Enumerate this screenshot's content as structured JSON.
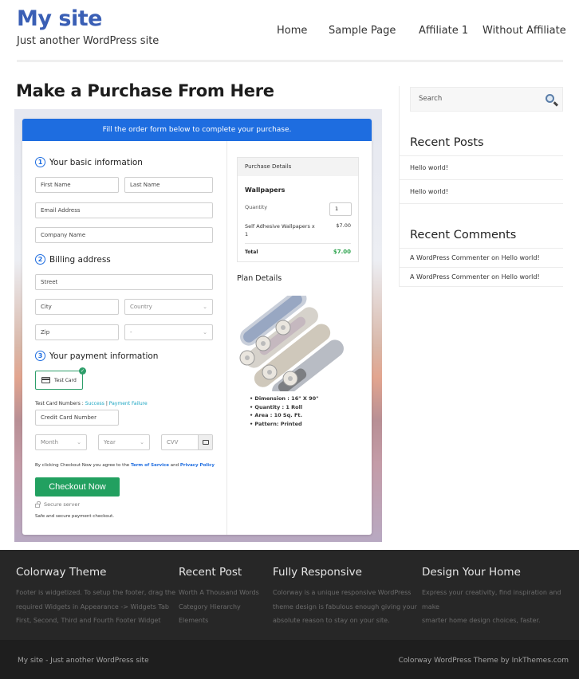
{
  "header": {
    "site_title": "My site",
    "tagline": "Just another WordPress site",
    "nav": [
      {
        "label": "Home"
      },
      {
        "label": "Sample Page"
      },
      {
        "label": "Affiliate 1"
      },
      {
        "label": "Without Affiliate"
      }
    ]
  },
  "main": {
    "page_title": "Make a Purchase From Here",
    "order_form": {
      "banner": "Fill the order form below to complete your purchase.",
      "steps": [
        {
          "num": "1",
          "label": "Your basic information"
        },
        {
          "num": "2",
          "label": "Billing address"
        },
        {
          "num": "3",
          "label": "Your payment information"
        }
      ],
      "fields": {
        "first_name": "First Name",
        "last_name": "Last Name",
        "email": "Email Address",
        "company": "Company Name",
        "street": "Street",
        "city": "City",
        "country": "Country",
        "zip": "Zip",
        "state": "-",
        "card_number": "Credit Card Number",
        "month": "Month",
        "year": "Year",
        "cvv": "CVV"
      },
      "payment_method": "Test Card",
      "test_numbers_label": "Test Card Numbers :",
      "test_success": "Success",
      "test_separator": "|",
      "test_failure": "Payment Failure",
      "agree_prefix": "By clicking Checkout Now you agree to the",
      "terms_link": "Term of Service",
      "agree_and": "and",
      "privacy_link": "Privacy Policy",
      "checkout_button": "Checkout Now",
      "secure_label": "Secure server",
      "safe_label": "Safe and secure payment checkout."
    },
    "purchase_details": {
      "heading": "Purchase Details",
      "product": "Wallpapers",
      "quantity_label": "Quantity",
      "quantity_value": "1",
      "item_label": "Self Adhesive Wallpapers x 1",
      "item_price": "$7.00",
      "total_label": "Total",
      "total_value": "$7.00"
    },
    "plan_details": {
      "heading": "Plan Details",
      "items": [
        "Dimension : 16\" X 90\"",
        "Quantity : 1 Roll",
        "Area : 10 Sq. Ft.",
        "Pattern: Printed"
      ]
    }
  },
  "sidebar": {
    "search_placeholder": "Search",
    "recent_posts_title": "Recent Posts",
    "recent_posts": [
      "Hello world!",
      "Hello world!"
    ],
    "recent_comments_title": "Recent Comments",
    "recent_comments": [
      "A WordPress Commenter on Hello world!",
      "A WordPress Commenter on Hello world!"
    ]
  },
  "footer": {
    "columns": [
      {
        "title": "Colorway Theme",
        "text": [
          "Footer is widgetized. To setup the footer, drag the",
          "required Widgets in Appearance -> Widgets Tab",
          "First, Second, Third and Fourth Footer Widget"
        ]
      },
      {
        "title": "Recent Post",
        "links": [
          "Worth A Thousand Words",
          "Category Hierarchy",
          "Elements"
        ]
      },
      {
        "title": "Fully Responsive",
        "text": [
          "Colorway is a unique responsive WordPress",
          "theme design is fabulous enough giving your",
          "absolute reason to stay on your site."
        ]
      },
      {
        "title": "Design Your Home",
        "text": [
          "Express your creativity, find inspiration and make",
          "smarter home design choices, faster."
        ]
      }
    ],
    "bottom_left": "My site - Just another WordPress site",
    "bottom_right": "Colorway WordPress Theme by InkThemes.com"
  },
  "colors": {
    "brand_blue": "#3a5fb5",
    "banner_blue": "#1e6de0",
    "checkout_green": "#22a060",
    "total_green": "#2ea44f",
    "footer_bg": "#272727"
  }
}
